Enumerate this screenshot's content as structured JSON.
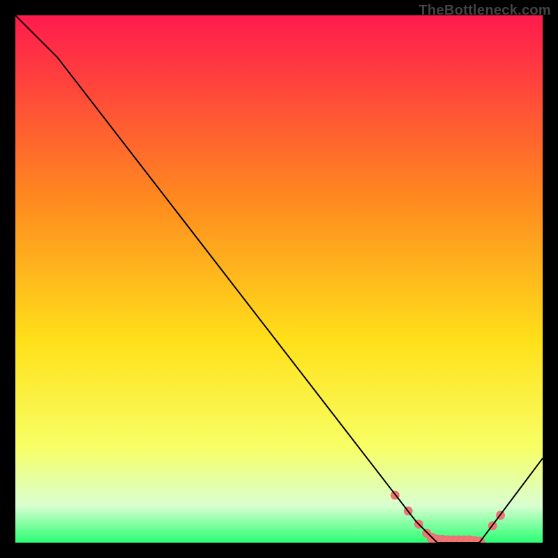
{
  "watermark": "TheBottleneck.com",
  "colors": {
    "bg_black": "#000000",
    "curve": "#000000",
    "marker_fill": "#f07575",
    "marker_stroke": "#e86a6a",
    "grad_top": "#ff1a4d",
    "grad_mid1": "#ff8a1f",
    "grad_mid2": "#ffe11a",
    "grad_low1": "#f7ff66",
    "grad_low2": "#d9ffd1",
    "grad_bottom": "#2aff73"
  },
  "chart_data": {
    "type": "line",
    "title": "",
    "xlabel": "",
    "ylabel": "",
    "xlim": [
      0,
      100
    ],
    "ylim": [
      0,
      100
    ],
    "curve": {
      "x": [
        0,
        8,
        76,
        80,
        88,
        100
      ],
      "y": [
        100,
        92,
        4,
        0,
        0,
        16
      ]
    },
    "markers": {
      "x": [
        72,
        74.5,
        76.5,
        78,
        79,
        80,
        81,
        82,
        83,
        84,
        85,
        86,
        87,
        88,
        90.5,
        92
      ],
      "y": [
        9,
        6,
        3.5,
        1.8,
        0.9,
        0.4,
        0.2,
        0,
        0,
        0,
        0,
        0,
        0,
        0,
        3.2,
        5.2
      ],
      "r": [
        6,
        6,
        6,
        6,
        7,
        8,
        9,
        10,
        10,
        10,
        10,
        10,
        9,
        8,
        6,
        6
      ]
    }
  }
}
